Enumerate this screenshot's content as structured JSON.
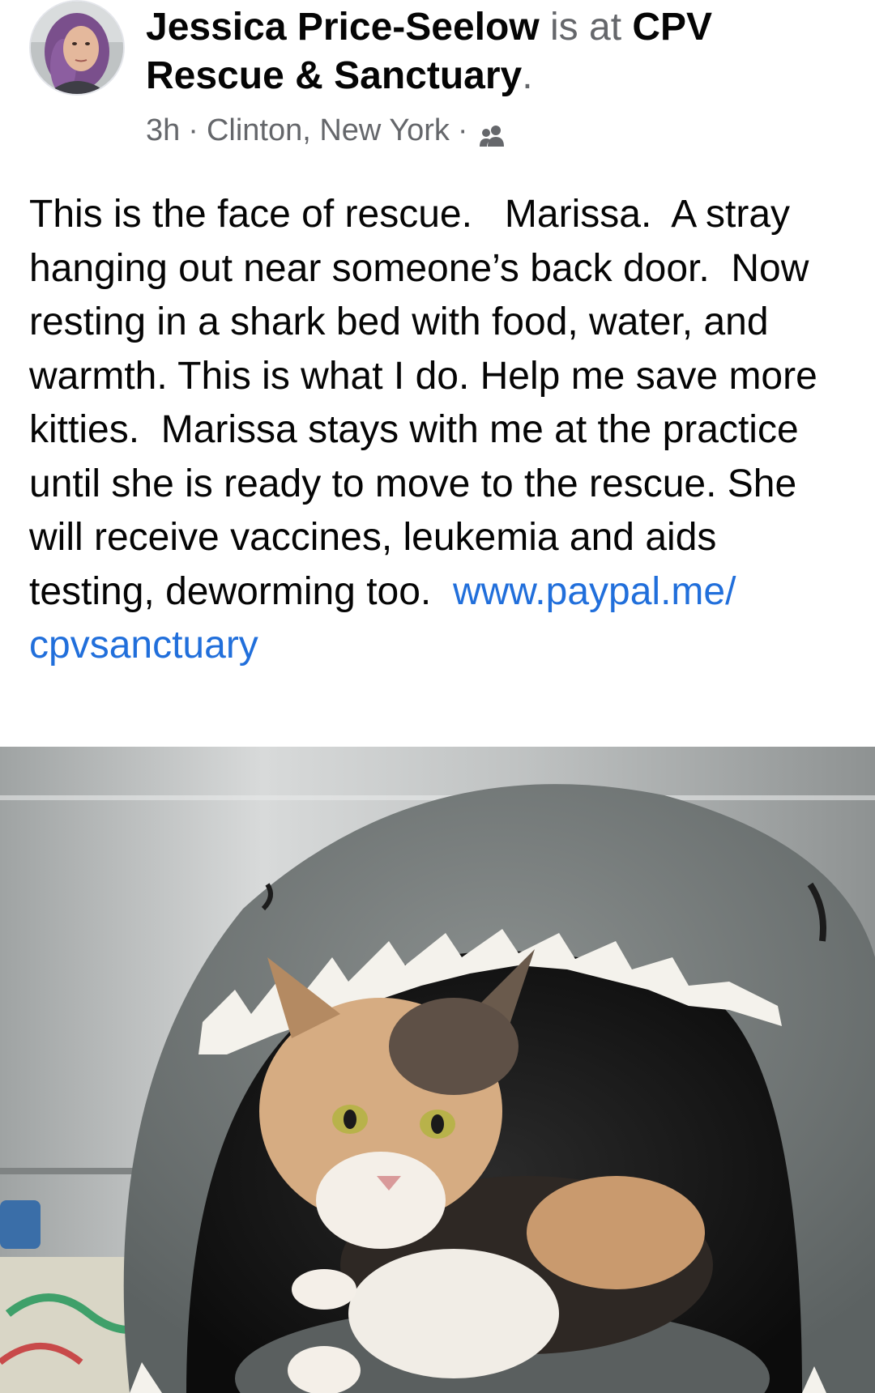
{
  "post": {
    "author": "Jessica Price-Seelow",
    "connector": " is at ",
    "place": "CPV Rescue & Sanctuary",
    "period": ".",
    "time": "3h",
    "separator": "·",
    "location": "Clinton, New York",
    "audience_icon": "friends-icon",
    "body_text": "This is the face of rescue.   Marissa.  A stray hanging out near someone’s back door.  Now resting in a shark bed with food, water, and warmth. This is what I do. Help me save more kitties.  Marissa stays with me at the practice until she is ready to move to the rescue. She will receive vaccines, leukemia and aids testing, deworming too.  ",
    "link_text": "www.paypal.me/\ncpvsanctuary"
  },
  "colors": {
    "text_primary": "#050505",
    "text_secondary": "#65676b",
    "link": "#216fdb",
    "background": "#ffffff"
  }
}
